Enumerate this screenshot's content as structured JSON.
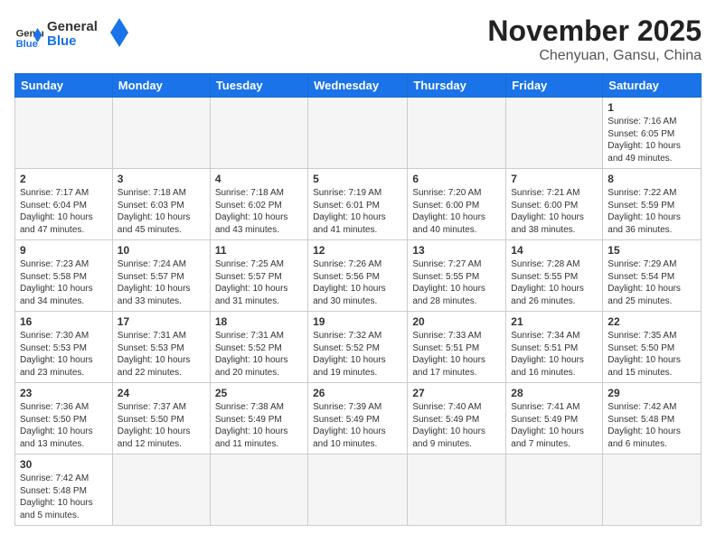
{
  "header": {
    "logo_general": "General",
    "logo_blue": "Blue",
    "month_title": "November 2025",
    "location": "Chenyuan, Gansu, China"
  },
  "weekdays": [
    "Sunday",
    "Monday",
    "Tuesday",
    "Wednesday",
    "Thursday",
    "Friday",
    "Saturday"
  ],
  "weeks": [
    [
      {
        "day": "",
        "info": ""
      },
      {
        "day": "",
        "info": ""
      },
      {
        "day": "",
        "info": ""
      },
      {
        "day": "",
        "info": ""
      },
      {
        "day": "",
        "info": ""
      },
      {
        "day": "",
        "info": ""
      },
      {
        "day": "1",
        "info": "Sunrise: 7:16 AM\nSunset: 6:05 PM\nDaylight: 10 hours and 49 minutes."
      }
    ],
    [
      {
        "day": "2",
        "info": "Sunrise: 7:17 AM\nSunset: 6:04 PM\nDaylight: 10 hours and 47 minutes."
      },
      {
        "day": "3",
        "info": "Sunrise: 7:18 AM\nSunset: 6:03 PM\nDaylight: 10 hours and 45 minutes."
      },
      {
        "day": "4",
        "info": "Sunrise: 7:18 AM\nSunset: 6:02 PM\nDaylight: 10 hours and 43 minutes."
      },
      {
        "day": "5",
        "info": "Sunrise: 7:19 AM\nSunset: 6:01 PM\nDaylight: 10 hours and 41 minutes."
      },
      {
        "day": "6",
        "info": "Sunrise: 7:20 AM\nSunset: 6:00 PM\nDaylight: 10 hours and 40 minutes."
      },
      {
        "day": "7",
        "info": "Sunrise: 7:21 AM\nSunset: 6:00 PM\nDaylight: 10 hours and 38 minutes."
      },
      {
        "day": "8",
        "info": "Sunrise: 7:22 AM\nSunset: 5:59 PM\nDaylight: 10 hours and 36 minutes."
      }
    ],
    [
      {
        "day": "9",
        "info": "Sunrise: 7:23 AM\nSunset: 5:58 PM\nDaylight: 10 hours and 34 minutes."
      },
      {
        "day": "10",
        "info": "Sunrise: 7:24 AM\nSunset: 5:57 PM\nDaylight: 10 hours and 33 minutes."
      },
      {
        "day": "11",
        "info": "Sunrise: 7:25 AM\nSunset: 5:57 PM\nDaylight: 10 hours and 31 minutes."
      },
      {
        "day": "12",
        "info": "Sunrise: 7:26 AM\nSunset: 5:56 PM\nDaylight: 10 hours and 30 minutes."
      },
      {
        "day": "13",
        "info": "Sunrise: 7:27 AM\nSunset: 5:55 PM\nDaylight: 10 hours and 28 minutes."
      },
      {
        "day": "14",
        "info": "Sunrise: 7:28 AM\nSunset: 5:55 PM\nDaylight: 10 hours and 26 minutes."
      },
      {
        "day": "15",
        "info": "Sunrise: 7:29 AM\nSunset: 5:54 PM\nDaylight: 10 hours and 25 minutes."
      }
    ],
    [
      {
        "day": "16",
        "info": "Sunrise: 7:30 AM\nSunset: 5:53 PM\nDaylight: 10 hours and 23 minutes."
      },
      {
        "day": "17",
        "info": "Sunrise: 7:31 AM\nSunset: 5:53 PM\nDaylight: 10 hours and 22 minutes."
      },
      {
        "day": "18",
        "info": "Sunrise: 7:31 AM\nSunset: 5:52 PM\nDaylight: 10 hours and 20 minutes."
      },
      {
        "day": "19",
        "info": "Sunrise: 7:32 AM\nSunset: 5:52 PM\nDaylight: 10 hours and 19 minutes."
      },
      {
        "day": "20",
        "info": "Sunrise: 7:33 AM\nSunset: 5:51 PM\nDaylight: 10 hours and 17 minutes."
      },
      {
        "day": "21",
        "info": "Sunrise: 7:34 AM\nSunset: 5:51 PM\nDaylight: 10 hours and 16 minutes."
      },
      {
        "day": "22",
        "info": "Sunrise: 7:35 AM\nSunset: 5:50 PM\nDaylight: 10 hours and 15 minutes."
      }
    ],
    [
      {
        "day": "23",
        "info": "Sunrise: 7:36 AM\nSunset: 5:50 PM\nDaylight: 10 hours and 13 minutes."
      },
      {
        "day": "24",
        "info": "Sunrise: 7:37 AM\nSunset: 5:50 PM\nDaylight: 10 hours and 12 minutes."
      },
      {
        "day": "25",
        "info": "Sunrise: 7:38 AM\nSunset: 5:49 PM\nDaylight: 10 hours and 11 minutes."
      },
      {
        "day": "26",
        "info": "Sunrise: 7:39 AM\nSunset: 5:49 PM\nDaylight: 10 hours and 10 minutes."
      },
      {
        "day": "27",
        "info": "Sunrise: 7:40 AM\nSunset: 5:49 PM\nDaylight: 10 hours and 9 minutes."
      },
      {
        "day": "28",
        "info": "Sunrise: 7:41 AM\nSunset: 5:49 PM\nDaylight: 10 hours and 7 minutes."
      },
      {
        "day": "29",
        "info": "Sunrise: 7:42 AM\nSunset: 5:48 PM\nDaylight: 10 hours and 6 minutes."
      }
    ],
    [
      {
        "day": "30",
        "info": "Sunrise: 7:42 AM\nSunset: 5:48 PM\nDaylight: 10 hours and 5 minutes."
      },
      {
        "day": "",
        "info": ""
      },
      {
        "day": "",
        "info": ""
      },
      {
        "day": "",
        "info": ""
      },
      {
        "day": "",
        "info": ""
      },
      {
        "day": "",
        "info": ""
      },
      {
        "day": "",
        "info": ""
      }
    ]
  ]
}
